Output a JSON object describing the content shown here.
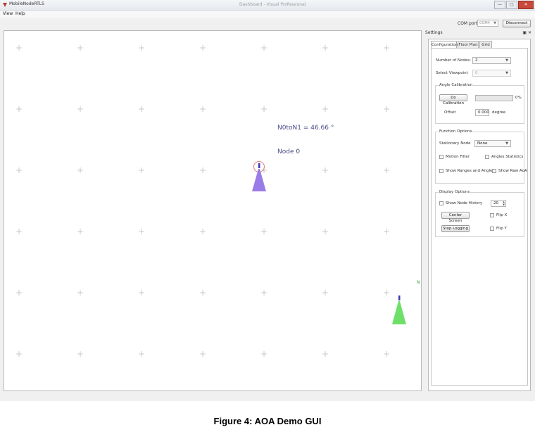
{
  "window": {
    "title": "MobileNodeRTLS",
    "center_title": "Dashboard - Visual Professional",
    "controls": {
      "minimize": "—",
      "maximize": "□",
      "close": "✕"
    }
  },
  "menu": {
    "items": [
      "View",
      "Help"
    ]
  },
  "toolbar": {
    "com_label": "COM port",
    "com_value": "COM4",
    "disconnect_label": "Disconnect"
  },
  "canvas": {
    "bearing_label": "N0toN1 = 46.66 °",
    "node_label": "Node 0",
    "grid_symbol": "+",
    "node0_color": "#9b7be8",
    "node1_color": "#6ee06a",
    "north_marker": "N"
  },
  "settings_dock": {
    "title": "Settings",
    "controls": "▣ ✕",
    "tabs": [
      "Configuration",
      "Floor Plan",
      "Grid"
    ],
    "active_tab": "Configuration",
    "number_of_nodes": {
      "label": "Number of Nodes:",
      "value": "2"
    },
    "select_viewpoint": {
      "label": "Select Viewpoint",
      "value": "0"
    },
    "angle_calibration": {
      "title": "Angle Calibration",
      "button": "Do Calibration",
      "progress_text": "0%",
      "progress_value": 0,
      "offset_label": "Offset",
      "offset_value": "0.000",
      "offset_unit": "degree"
    },
    "function_options": {
      "title": "Function Options",
      "stationary_label": "Stationary Node",
      "stationary_value": "None",
      "motion_filter": "Motion Filter",
      "angles_statistics": "Angles Statistics",
      "show_ranges": "Show Ranges and Angles",
      "show_raw_aoa": "Show Raw AoA"
    },
    "display_options": {
      "title": "Display Options",
      "show_node_history": "Show Node History",
      "history_value": "20",
      "center_screen": "Center Screen",
      "flip_x": "Flip X",
      "stop_logging": "Stop Logging",
      "flip_y": "Flip Y"
    }
  },
  "caption": "Figure 4: AOA Demo GUI"
}
